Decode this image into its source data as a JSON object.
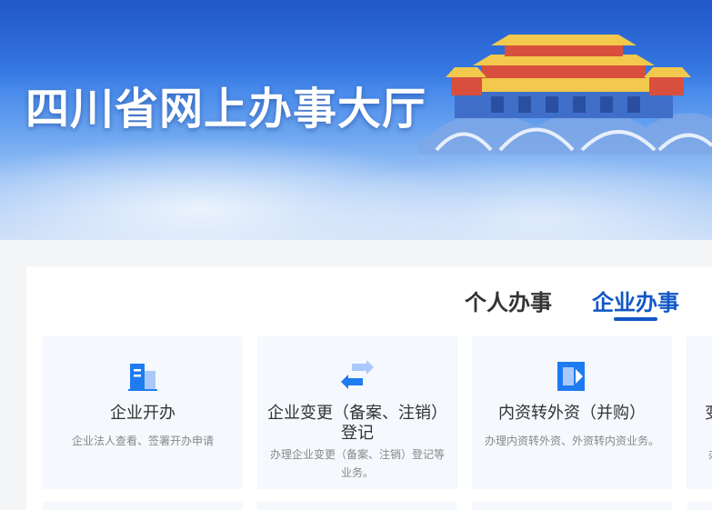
{
  "banner": {
    "title": "四川省网上办事大厅"
  },
  "tabs": [
    {
      "label": "个人办事",
      "active": false
    },
    {
      "label": "企业办事",
      "active": true
    }
  ],
  "accent_color": "#1156c6",
  "services": [
    {
      "name": "企业开办",
      "description": "企业法人查看、签署开办申请",
      "icon": "building-icon"
    },
    {
      "name": "企业变更（备案、注销）登记",
      "description": "办理企业变更（备案、注销）登记等业务。",
      "icon": "exchange-arrows-icon"
    },
    {
      "name": "内资转外资（并购）",
      "description": "办理内资转外资、外资转内资业务。",
      "icon": "transfer-icon"
    },
    {
      "name": "变",
      "description": "办",
      "icon": ""
    }
  ]
}
